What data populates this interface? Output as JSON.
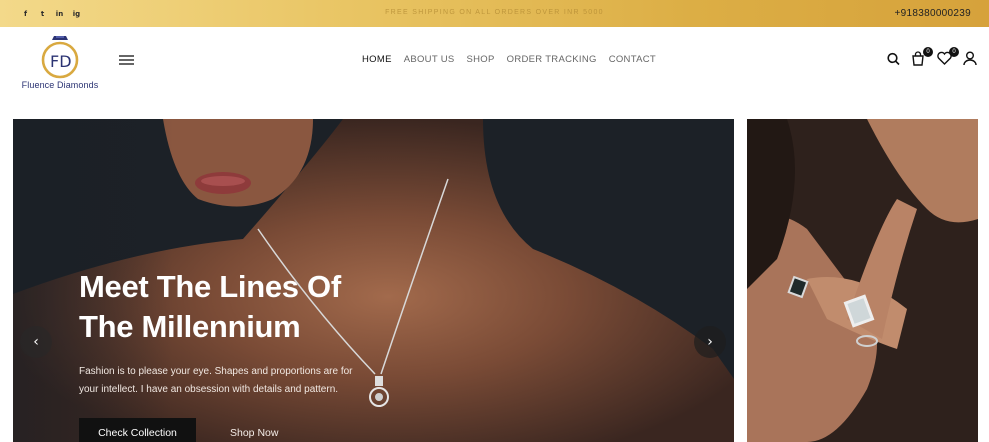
{
  "topbar": {
    "social": [
      "f",
      "t",
      "in",
      "ig"
    ],
    "social_icons": [
      "facebook-icon",
      "twitter-icon",
      "instagram-icon",
      "pinterest-icon"
    ],
    "promo": "FREE SHIPPING ON ALL ORDERS OVER INR 5000",
    "phone": "+918380000239",
    "gradient_start": "#f3d98a",
    "gradient_end": "#d6a23b"
  },
  "header": {
    "logo_text": "Fluence Diamonds",
    "logo_monogram": "FD",
    "nav": [
      "HOME",
      "ABOUT US",
      "SHOP",
      "ORDER TRACKING",
      "CONTACT"
    ],
    "active_nav": "HOME",
    "cart_count": "0",
    "wishlist_count": "0",
    "icons": [
      "search-icon",
      "cart-icon",
      "wishlist-icon",
      "account-icon"
    ]
  },
  "hero": {
    "title_line1": "Meet The Lines Of",
    "title_line2": "The Millennium",
    "subtitle_line1": "Fashion is to please your eye. Shapes and proportions are for",
    "subtitle_line2": "your intellect. I have an obsession with details and pattern.",
    "primary_button": "Check Collection",
    "secondary_button": "Shop Now",
    "prev_arrow": "‹",
    "next_arrow": "›"
  },
  "colors": {
    "brand": "#2b3373",
    "gold": "#d9a940",
    "button_dark": "#111111"
  }
}
